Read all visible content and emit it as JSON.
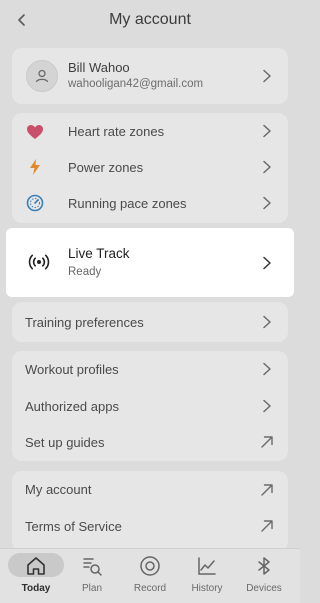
{
  "header": {
    "title": "My account",
    "back_icon": "chevron-left-icon"
  },
  "profile": {
    "name": "Bill Wahoo",
    "email": "wahooligan42@gmail.com",
    "avatar_icon": "user-icon"
  },
  "zones": [
    {
      "label": "Heart rate zones",
      "icon": "heart-icon",
      "color": "#c9506a"
    },
    {
      "label": "Power zones",
      "icon": "lightning-icon",
      "color": "#e0892a"
    },
    {
      "label": "Running pace zones",
      "icon": "speedometer-icon",
      "color": "#3a7fb5"
    }
  ],
  "live_track": {
    "title": "Live Track",
    "status": "Ready",
    "icon": "broadcast-icon"
  },
  "training": {
    "label": "Training preferences"
  },
  "more": [
    {
      "label": "Workout profiles",
      "action": "chevron"
    },
    {
      "label": "Authorized apps",
      "action": "chevron"
    },
    {
      "label": "Set up guides",
      "action": "external"
    }
  ],
  "legal": [
    {
      "label": "My account",
      "action": "external"
    },
    {
      "label": "Terms of Service",
      "action": "external"
    }
  ],
  "nav": [
    {
      "label": "Today",
      "icon": "home-icon",
      "active": true
    },
    {
      "label": "Plan",
      "icon": "plan-icon",
      "active": false
    },
    {
      "label": "Record",
      "icon": "record-icon",
      "active": false
    },
    {
      "label": "History",
      "icon": "history-chart-icon",
      "active": false
    },
    {
      "label": "Devices",
      "icon": "bluetooth-icon",
      "active": false
    }
  ]
}
